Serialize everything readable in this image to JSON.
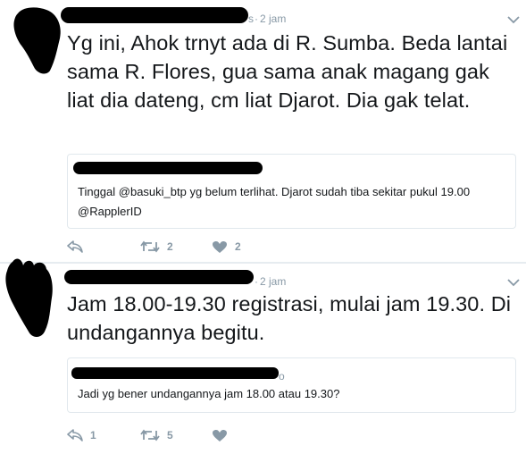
{
  "tweets": [
    {
      "time": "2 jam",
      "handle_tail": "s",
      "text": "Yg ini, Ahok trnyt ada di R. Sumba. Beda lantai sama R. Flores, gua sama anak magang gak liat dia dateng, cm liat Djarot. Dia gak telat.",
      "quote": {
        "text": "Tinggal @basuki_btp yg belum terlihat. Djarot sudah tiba sekitar pukul 19.00 @RapplerID"
      },
      "actions": {
        "reply": "",
        "retweet": "2",
        "like": "2"
      }
    },
    {
      "time": "2 jam",
      "handle_tail": "",
      "text": "Jam 18.00-19.30 registrasi, mulai jam 19.30. Di undangannya begitu.",
      "quote": {
        "handle_tail": "o",
        "text": "Jadi yg bener undangannya jam 18.00 atau 19.30?"
      },
      "actions": {
        "reply": "1",
        "retweet": "5",
        "like": ""
      }
    }
  ],
  "icons": {
    "reply": "reply-icon",
    "retweet": "retweet-icon",
    "like": "heart-icon",
    "more": "chevron-down-icon"
  },
  "colors": {
    "text": "#14171a",
    "meta": "#8899a6",
    "border": "#e1e8ed",
    "redaction": "#000000"
  }
}
